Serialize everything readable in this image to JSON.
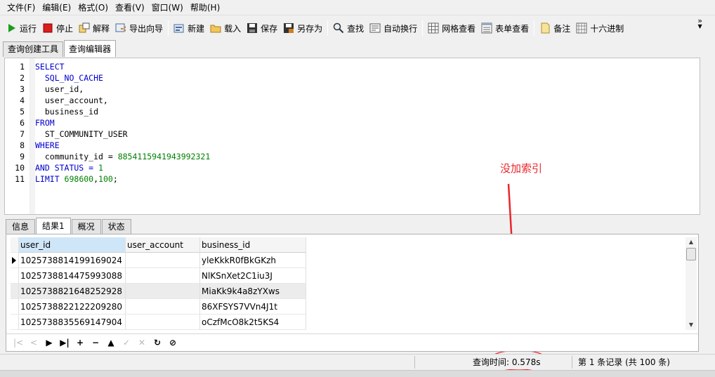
{
  "menu": [
    "文件(F)",
    "编辑(E)",
    "格式(O)",
    "查看(V)",
    "窗口(W)",
    "帮助(H)"
  ],
  "toolbar": {
    "run": "运行",
    "stop": "停止",
    "explain": "解释",
    "export_wizard": "导出向导",
    "new": "新建",
    "load": "载入",
    "save": "保存",
    "save_as": "另存为",
    "find": "查找",
    "word_wrap": "自动换行",
    "grid_view": "网格查看",
    "form_view": "表单查看",
    "memo": "备注",
    "hex": "十六进制"
  },
  "top_tabs": [
    "查询创建工具",
    "查询编辑器"
  ],
  "editor_lines": [
    {
      "n": "1",
      "parts": [
        {
          "t": "SELECT",
          "c": "kw"
        }
      ]
    },
    {
      "n": "2",
      "parts": [
        {
          "t": "  SQL_NO_CACHE",
          "c": "kw"
        }
      ]
    },
    {
      "n": "3",
      "parts": [
        {
          "t": "  user_id,",
          "c": "pl"
        }
      ]
    },
    {
      "n": "4",
      "parts": [
        {
          "t": "  user_account,",
          "c": "pl"
        }
      ]
    },
    {
      "n": "5",
      "parts": [
        {
          "t": "  business_id",
          "c": "pl"
        }
      ]
    },
    {
      "n": "6",
      "parts": [
        {
          "t": "FROM",
          "c": "kw"
        }
      ]
    },
    {
      "n": "7",
      "parts": [
        {
          "t": "  ST_COMMUNITY_USER",
          "c": "pl"
        }
      ]
    },
    {
      "n": "8",
      "parts": [
        {
          "t": "WHERE",
          "c": "kw"
        }
      ]
    },
    {
      "n": "9",
      "parts": [
        {
          "t": "  community_id = ",
          "c": "pl"
        },
        {
          "t": "8854115941943992321",
          "c": "num"
        }
      ]
    },
    {
      "n": "10",
      "parts": [
        {
          "t": "AND STATUS = ",
          "c": "kw"
        },
        {
          "t": "1",
          "c": "num"
        }
      ]
    },
    {
      "n": "11",
      "parts": [
        {
          "t": "LIMIT ",
          "c": "kw"
        },
        {
          "t": "698600",
          "c": "num"
        },
        {
          "t": ",",
          "c": "pl"
        },
        {
          "t": "100",
          "c": "num"
        },
        {
          "t": ";",
          "c": "pl"
        }
      ]
    }
  ],
  "annotation": {
    "text": "没加索引",
    "color": "#e8262b"
  },
  "result_tabs": [
    "信息",
    "结果1",
    "概况",
    "状态"
  ],
  "grid": {
    "columns": [
      "user_id",
      "user_account",
      "business_id"
    ],
    "rows": [
      [
        "1025738814199169024",
        "",
        "yleKkkR0fBkGKzh"
      ],
      [
        "1025738814475993088",
        "",
        "NlKSnXet2C1iu3J"
      ],
      [
        "1025738821648252928",
        "",
        "MiaKk9k4a8zYXws"
      ],
      [
        "1025738822122209280",
        "",
        "86XFSYS7VVn4J1t"
      ],
      [
        "1025738835569147904",
        "",
        "oCzfMcO8k2t5KS4"
      ]
    ]
  },
  "status": {
    "query_time": "查询时间: 0.578s",
    "record_info": "第 1 条记录 (共 100 条)"
  },
  "colors": {
    "keyword": "#0000cc",
    "number": "#008000",
    "accent_red": "#e8262b"
  }
}
